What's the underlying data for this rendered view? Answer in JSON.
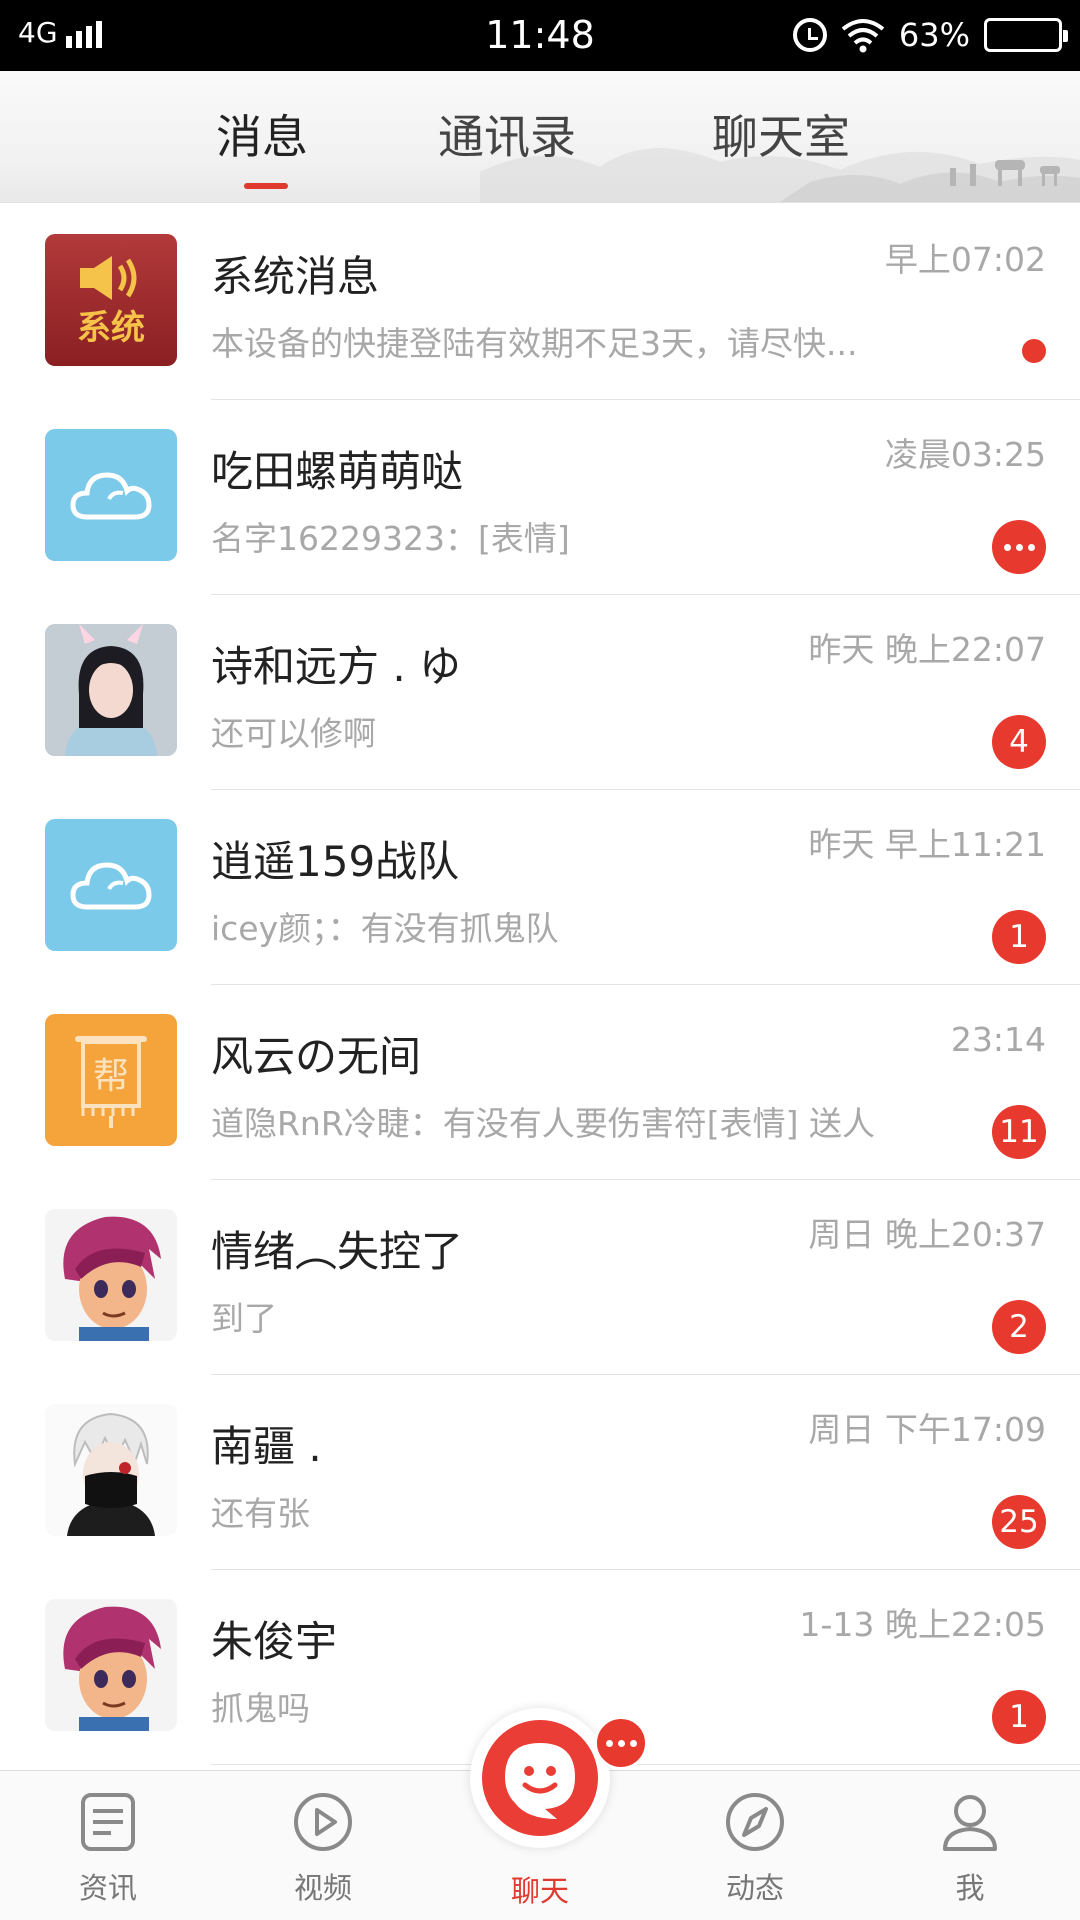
{
  "status_bar": {
    "network": "4G",
    "time": "11:48",
    "battery_text": "63%",
    "battery_level": 0.63
  },
  "tabs": [
    {
      "label": "消息",
      "active": true
    },
    {
      "label": "通讯录",
      "active": false
    },
    {
      "label": "聊天室",
      "active": false
    }
  ],
  "conversations": [
    {
      "name": "系统消息",
      "time": "早上07:02",
      "preview": "本设备的快捷登陆有效期不足3天，请尽快...",
      "avatar": "system-speaker-icon",
      "avatar_text": "系统",
      "indicator": "dot"
    },
    {
      "name": "吃田螺萌萌哒",
      "time": "凌晨03:25",
      "preview": "名字16229323：[表情]",
      "avatar": "cloud-icon",
      "indicator": "more"
    },
    {
      "name": "诗和远方 . ゆ",
      "time": "昨天  晚上22:07",
      "preview": "还可以修啊",
      "avatar": "user-photo",
      "badge": "4"
    },
    {
      "name": "逍遥159战队",
      "time": "昨天  早上11:21",
      "preview": "icey颜；：有没有抓鬼队",
      "avatar": "cloud-icon",
      "badge": "1"
    },
    {
      "name": "风云の无间",
      "time": "23:14",
      "preview": "道隐RnR冷睫：有没有人要伤害符[表情] 送人",
      "avatar": "guild-banner-icon",
      "avatar_text": "帮",
      "badge": "11"
    },
    {
      "name": "情绪︵失控了",
      "time": "周日  晚上20:37",
      "preview": "到了",
      "avatar": "cartoon-avatar",
      "badge": "2"
    },
    {
      "name": "南疆 .",
      "time": "周日  下午17:09",
      "preview": " 还有张",
      "avatar": "mask-avatar",
      "badge": "25"
    },
    {
      "name": "朱俊宇",
      "time": "1-13  晚上22:05",
      "preview": "抓鬼吗",
      "avatar": "cartoon-avatar",
      "badge": "1"
    }
  ],
  "bottom_nav": [
    {
      "label": "资讯",
      "icon": "news-icon"
    },
    {
      "label": "视频",
      "icon": "play-icon"
    },
    {
      "label": "聊天",
      "icon": "chat-smile-icon",
      "active": true
    },
    {
      "label": "动态",
      "icon": "compass-icon"
    },
    {
      "label": "我",
      "icon": "person-icon"
    }
  ],
  "colors": {
    "accent": "#e8392e",
    "cloud_avatar": "#7ccaea",
    "guild_avatar": "#f5a33b",
    "status_bar": "#000000"
  }
}
